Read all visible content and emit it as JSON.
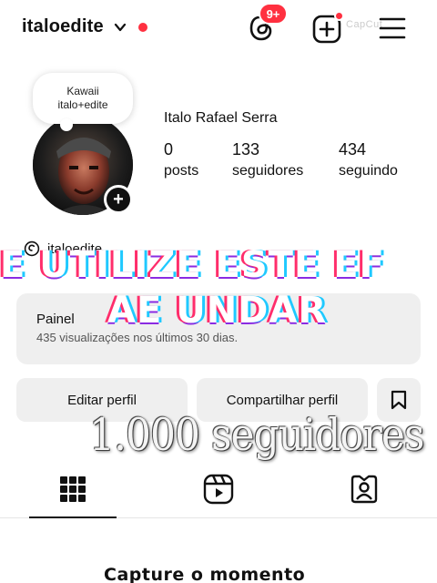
{
  "header": {
    "username": "italoedite",
    "notification_count": "9+",
    "watermark": "CapCut"
  },
  "note": {
    "line1": "Kawaii",
    "line2": "italo+edite"
  },
  "profile": {
    "full_name": "Italo Rafael Serra",
    "threads_handle": "italoedite",
    "stats": [
      {
        "value": "0",
        "label": "posts"
      },
      {
        "value": "133",
        "label": "seguidores"
      },
      {
        "value": "434",
        "label": "seguindo"
      }
    ]
  },
  "glitch_overlay": {
    "line1": "E UTILIZE ESTE EF",
    "line2": "AE UNDAR"
  },
  "panel": {
    "title": "Painel",
    "subtitle": "435 visualizações nos últimos 30 dias."
  },
  "buttons": {
    "edit_profile": "Editar perfil",
    "share_profile": "Compartilhar perfil"
  },
  "overlay_text": "1.000 seguidores",
  "bottom_caption": "Capture o momento",
  "colors": {
    "accent_red": "#ff3040",
    "button_bg": "#efefef"
  },
  "icons": {
    "threads": "threads-icon",
    "add_post": "add-post-icon",
    "menu": "menu-icon",
    "bookmark": "bookmark-icon",
    "grid": "grid-icon",
    "reels": "reels-icon",
    "tagged": "tagged-icon"
  }
}
